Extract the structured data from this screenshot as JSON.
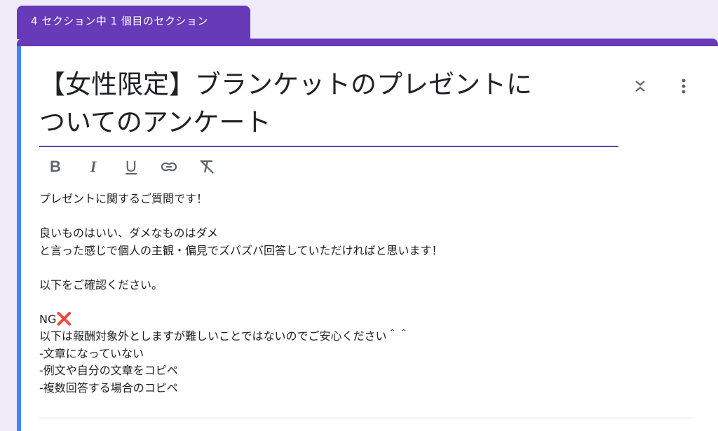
{
  "section_tab": {
    "label": "4 セクション中 1 個目のセクション"
  },
  "title": "【女性限定】ブランケットのプレゼントに\nついてのアンケート",
  "toolbar": {
    "bold": "B",
    "italic": "I",
    "underline": "U"
  },
  "description": {
    "line1": "プレゼントに関するご質問です！",
    "line2": "良いものはいい、ダメなものはダメ",
    "line3": "と言った感じで個人の主観・偏見でズバズバ回答していただければと思います！",
    "line4": "以下をご確認ください。",
    "line5_text": "NG",
    "line5_mark": "❌",
    "line6": "以下は報酬対象外としますが難しいことではないのでご安心ください＾＾",
    "line7": "-文章になっていない",
    "line8": "-例文や自分の文章をコピペ",
    "line9": "-複数回答する場合のコピペ"
  },
  "colors": {
    "accent": "#673ab7",
    "focus_bar": "#4285f4",
    "background": "#f0ebf8",
    "ng_mark": "#e0245e"
  },
  "icons": [
    "collapse-icon",
    "more-vert-icon",
    "link-icon",
    "clear-format-icon"
  ]
}
